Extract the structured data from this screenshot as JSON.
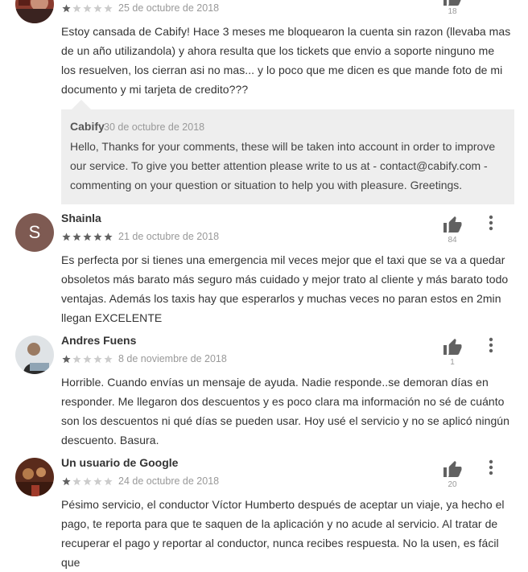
{
  "colors": {
    "star_filled": "#616161",
    "star_empty": "#cccccc",
    "icon": "#616161",
    "reply_bg": "#eeeeee",
    "avatar_s": "#7e5a52"
  },
  "reviews": [
    {
      "author": "",
      "rating": 1,
      "date": "25 de octubre de 2018",
      "likes": "18",
      "text": "Estoy cansada de Cabify! Hace 3 meses me bloquearon la cuenta sin razon (llevaba mas de un año utilizandola) y ahora resulta que los tickets que envio a soporte ninguno me los resuelven, los cierran asi no mas... y lo poco que me dicen es que mande foto de mi documento y mi tarjeta de credito???",
      "reply": {
        "author": "Cabify",
        "date": "30 de octubre de 2018",
        "text": "Hello, Thanks for your comments, these will be taken into account in order to improve our service. To give you better attention please write to us at - contact@cabify.com - commenting on your question or situation to help you with pleasure. Greetings."
      }
    },
    {
      "author": "Shainla",
      "avatar_letter": "S",
      "rating": 5,
      "date": "21 de octubre de 2018",
      "likes": "84",
      "text": "Es perfecta por si tienes una emergencia mil veces mejor que el taxi que se va a quedar obsoletos más barato más seguro más cuidado y mejor trato al cliente y más barato todo ventajas. Además los taxis hay que esperarlos y muchas veces no paran estos en 2min llegan EXCELENTE"
    },
    {
      "author": "Andres Fuens",
      "rating": 1,
      "date": "8 de noviembre de 2018",
      "likes": "1",
      "text": "Horrible. Cuando envías un mensaje de ayuda. Nadie responde..se demoran días en responder. Me llegaron dos descuentos y es poco clara ma información no sé de cuánto son los descuentos ni qué días se pueden usar. Hoy usé el servicio y no se aplicó ningún descuento. Basura."
    },
    {
      "author": "Un usuario de Google",
      "rating": 1,
      "date": "24 de octubre de 2018",
      "likes": "20",
      "text": "Pésimo servicio, el conductor Víctor Humberto después de aceptar un viaje, ya hecho el pago, te reporta para que te saquen de la aplicación y no acude al servicio. Al tratar de recuperar el pago y reportar al conductor, nunca recibes respuesta. No la usen, es fácil que"
    }
  ]
}
